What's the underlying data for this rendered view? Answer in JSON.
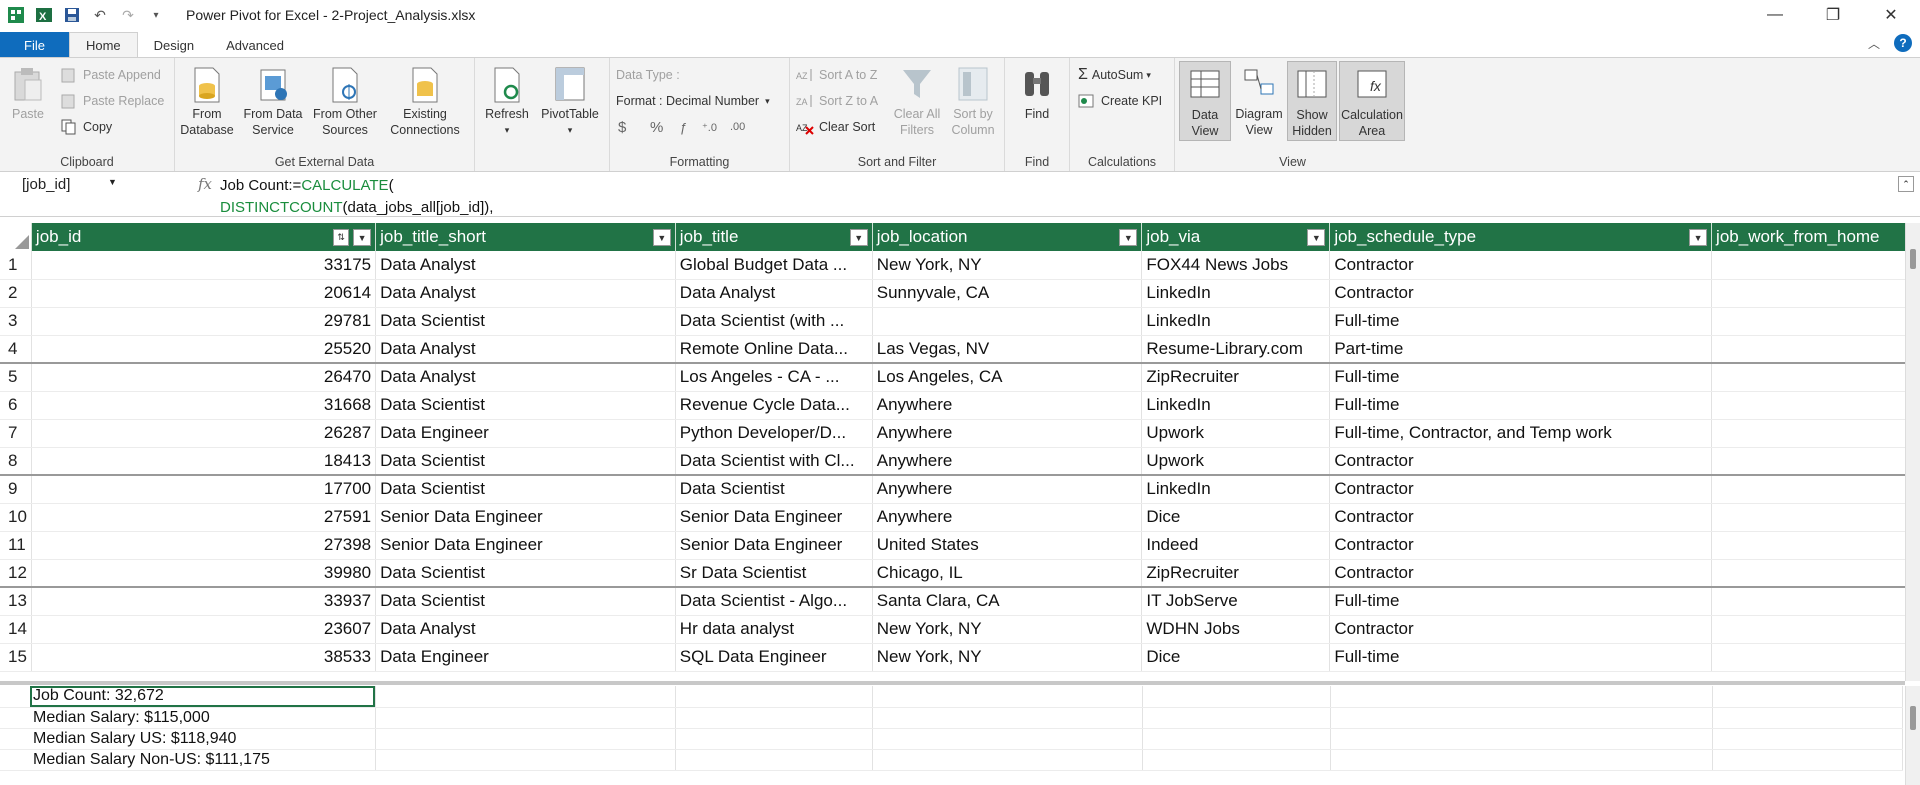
{
  "window": {
    "title": "Power Pivot for Excel - 2-Project_Analysis.xlsx",
    "minimize": "—",
    "restore": "❐",
    "close": "✕"
  },
  "tabs": [
    {
      "label": "File"
    },
    {
      "label": "Home"
    },
    {
      "label": "Design"
    },
    {
      "label": "Advanced"
    }
  ],
  "help_label": "?",
  "ribbon": {
    "clipboard": {
      "label": "Clipboard",
      "paste": "Paste",
      "paste_append": "Paste Append",
      "paste_replace": "Paste Replace",
      "copy": "Copy"
    },
    "external": {
      "label": "Get External Data",
      "from_database": [
        "From",
        "Database"
      ],
      "from_data_service": [
        "From Data",
        "Service"
      ],
      "from_other_sources": [
        "From Other",
        "Sources"
      ],
      "existing_connections": [
        "Existing",
        "Connections"
      ]
    },
    "refresh": "Refresh",
    "pivottable": "PivotTable",
    "formatting": {
      "label": "Formatting",
      "data_type": "Data Type :",
      "format": "Format : Decimal Number",
      "currency": "$",
      "percent": "%",
      "comma": "ƒ"
    },
    "sort_filter": {
      "label": "Sort and Filter",
      "sort_a_z": "Sort A to Z",
      "sort_z_a": "Sort Z to A",
      "clear_sort": "Clear Sort",
      "clear_all_filters": [
        "Clear All",
        "Filters"
      ],
      "sort_by_column": [
        "Sort by",
        "Column"
      ]
    },
    "find_group": {
      "label": "Find",
      "find": "Find"
    },
    "calculations": {
      "label": "Calculations",
      "autosum": "AutoSum",
      "create_kpi": "Create KPI"
    },
    "view": {
      "label": "View",
      "data_view": [
        "Data",
        "View"
      ],
      "diagram_view": [
        "Diagram",
        "View"
      ],
      "show_hidden": [
        "Show",
        "Hidden"
      ],
      "calculation_area": [
        "Calculation",
        "Area"
      ]
    }
  },
  "formula_bar": {
    "name_box": "[job_id]",
    "fx": "fx",
    "line1_prefix": "Job Count:=",
    "line1_kw": "CALCULATE",
    "line1_suffix": "(",
    "line2_kw": "DISTINCTCOUNT",
    "line2_suffix": "(data_jobs_all[job_id]),"
  },
  "columns": [
    "job_id",
    "job_title_short",
    "job_title",
    "job_location",
    "job_via",
    "job_schedule_type",
    "job_work_from_home"
  ],
  "rows": [
    [
      "1",
      "33175",
      "Data Analyst",
      "Global Budget Data ...",
      "New York, NY",
      "FOX44 News Jobs",
      "Contractor"
    ],
    [
      "2",
      "20614",
      "Data Analyst",
      "Data Analyst",
      "Sunnyvale, CA",
      "LinkedIn",
      "Contractor"
    ],
    [
      "3",
      "29781",
      "Data Scientist",
      "Data Scientist (with ...",
      "",
      "LinkedIn",
      "Full-time"
    ],
    [
      "4",
      "25520",
      "Data Analyst",
      "Remote Online Data...",
      "Las Vegas, NV",
      "Resume-Library.com",
      "Part-time"
    ],
    [
      "5",
      "26470",
      "Data Analyst",
      "Los Angeles - CA - ...",
      "Los Angeles, CA",
      "ZipRecruiter",
      "Full-time"
    ],
    [
      "6",
      "31668",
      "Data Scientist",
      "Revenue Cycle Data...",
      "Anywhere",
      "LinkedIn",
      "Full-time"
    ],
    [
      "7",
      "26287",
      "Data Engineer",
      "Python Developer/D...",
      "Anywhere",
      "Upwork",
      "Full-time, Contractor, and Temp work"
    ],
    [
      "8",
      "18413",
      "Data Scientist",
      "Data Scientist with Cl...",
      "Anywhere",
      "Upwork",
      "Contractor"
    ],
    [
      "9",
      "17700",
      "Data Scientist",
      "Data Scientist",
      "Anywhere",
      "LinkedIn",
      "Contractor"
    ],
    [
      "10",
      "27591",
      "Senior Data Engineer",
      "Senior Data Engineer",
      "Anywhere",
      "Dice",
      "Contractor"
    ],
    [
      "11",
      "27398",
      "Senior Data Engineer",
      "Senior Data Engineer",
      "United States",
      "Indeed",
      "Contractor"
    ],
    [
      "12",
      "39980",
      "Data Scientist",
      "Sr Data Scientist",
      "Chicago, IL",
      "ZipRecruiter",
      "Contractor"
    ],
    [
      "13",
      "33937",
      "Data Scientist",
      "Data Scientist - Algo...",
      "Santa Clara, CA",
      "IT JobServe",
      "Full-time"
    ],
    [
      "14",
      "23607",
      "Data Analyst",
      "Hr data analyst",
      "New York, NY",
      "WDHN Jobs",
      "Contractor"
    ],
    [
      "15",
      "38533",
      "Data Engineer",
      "SQL Data Engineer",
      "New York, NY",
      "Dice",
      "Full-time"
    ]
  ],
  "measures": [
    "Job Count: 32,672",
    "Median Salary: $115,000",
    "Median Salary US: $118,940",
    "Median Salary Non-US: $111,175"
  ]
}
